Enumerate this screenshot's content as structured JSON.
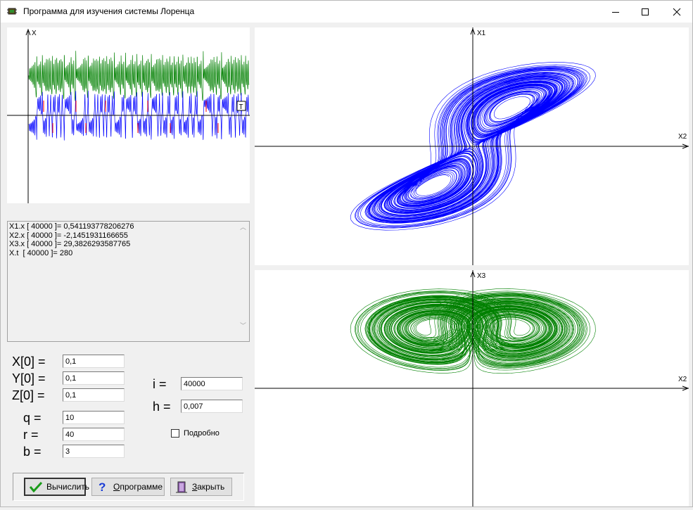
{
  "window": {
    "title": "Программа для изучения системы Лоренца",
    "icon": "app-chip-icon",
    "controls": [
      "minimize-icon",
      "maximize-icon",
      "close-icon"
    ]
  },
  "colors": {
    "trajectory_xy": "#0000ff",
    "trajectory_xz": "#008000",
    "marker": "#ff0000",
    "axis": "#000000"
  },
  "mini_plot": {
    "y_axis_label": "X",
    "marker_label": "T"
  },
  "xy_plot": {
    "y_axis_label": "X1",
    "x_axis_label": "X2"
  },
  "xz_plot": {
    "y_axis_label": "X3",
    "x_axis_label": "X2"
  },
  "output": {
    "lines": [
      "X1.x [ 40000 ]= 0,541193778206276",
      "X2.x [ 40000 ]= -2,1451931166655",
      "X3.x [ 40000 ]= 29,3826293587765",
      "X.t  [ 40000 ]= 280"
    ]
  },
  "params": {
    "x0": {
      "label": "X[0] =",
      "value": "0,1"
    },
    "y0": {
      "label": "Y[0] =",
      "value": "0,1"
    },
    "z0": {
      "label": "Z[0] =",
      "value": "0,1"
    },
    "q": {
      "label": "q =",
      "value": "10"
    },
    "r": {
      "label": "r =",
      "value": "40"
    },
    "b": {
      "label": "b =",
      "value": "3"
    },
    "i": {
      "label": "i =",
      "value": "40000"
    },
    "h": {
      "label": "h =",
      "value": "0,007"
    }
  },
  "options": {
    "detailed_label": "Подробно",
    "detailed_checked": false
  },
  "buttons": {
    "calculate": {
      "label": "Вычислить",
      "icon": "checkmark-icon"
    },
    "about": {
      "hotkey": "О",
      "rest": " программе",
      "icon": "question-icon"
    },
    "close": {
      "hotkey": "З",
      "rest": "акрыть",
      "icon": "door-exit-icon"
    }
  }
}
